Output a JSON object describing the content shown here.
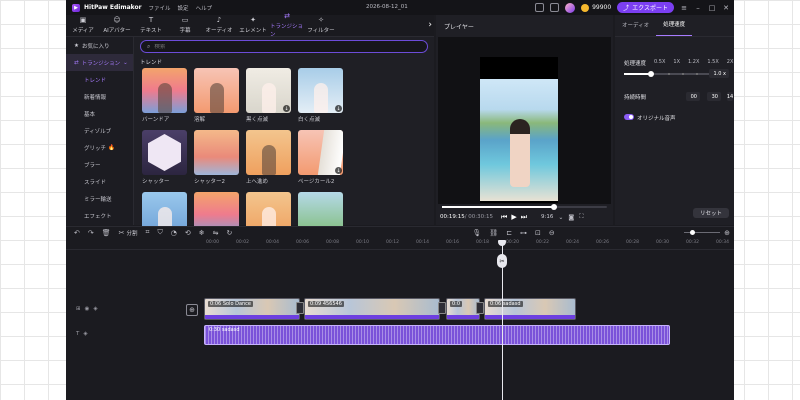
{
  "app": {
    "name": "HitPaw Edimakor",
    "menu": [
      "ファイル",
      "設定",
      "ヘルプ"
    ],
    "project_date": "2026-08-12_01",
    "coins": "99900",
    "export_label": "エクスポート"
  },
  "tabs": [
    {
      "label": "メディア",
      "icon": "▣"
    },
    {
      "label": "AIアバター",
      "icon": "☺"
    },
    {
      "label": "テキスト",
      "icon": "T"
    },
    {
      "label": "字幕",
      "icon": "▭"
    },
    {
      "label": "オーディオ",
      "icon": "♪"
    },
    {
      "label": "エレメント",
      "icon": "✦"
    },
    {
      "label": "トランジション",
      "icon": "⇄"
    },
    {
      "label": "フィルター",
      "icon": "✧"
    }
  ],
  "sidebar": {
    "favorites": "お気に入り",
    "transitions": "トランジション",
    "subs": [
      "トレンド",
      "新着情報",
      "基本",
      "ディゾルブ",
      "グリッチ",
      "ブラー",
      "スライド",
      "ミラー輪送",
      "エフェクト"
    ]
  },
  "search": {
    "placeholder": "検索"
  },
  "section": {
    "title": "トレンド"
  },
  "thumbnails": [
    {
      "label": "バーンドア"
    },
    {
      "label": "溶解"
    },
    {
      "label": "黒く点滅"
    },
    {
      "label": "白く点滅"
    },
    {
      "label": "シャッター"
    },
    {
      "label": "シャッター2"
    },
    {
      "label": "上へ進め"
    },
    {
      "label": "ページカール2"
    },
    {
      "label": ""
    },
    {
      "label": ""
    },
    {
      "label": ""
    },
    {
      "label": ""
    }
  ],
  "player": {
    "title": "プレイヤー",
    "current_time": "00:19:15",
    "total_time": "/ 00:30:15",
    "aspect": "9:16",
    "progress": 0.68
  },
  "properties": {
    "tabs": [
      "オーディオ",
      "処理速度"
    ],
    "speed_label": "処理速度",
    "speed_ticks": [
      "0.5X",
      "1X",
      "1.2X",
      "1.5X",
      "2X"
    ],
    "speed_value": "1.0",
    "speed_unit": "x",
    "duration_label": "持続時間",
    "duration": [
      "00",
      "30",
      "14"
    ],
    "pitch_label": "オリジナル音声",
    "reset_label": "リセット"
  },
  "toolbar": {
    "split_label": "分割"
  },
  "ruler": [
    "00:00",
    "00:02",
    "00:04",
    "00:06",
    "00:08",
    "00:10",
    "00:12",
    "00:14",
    "00:16",
    "00:18",
    "00:20",
    "00:22",
    "00:24",
    "00:26",
    "00:28",
    "00:30",
    "00:32",
    "00:34",
    "00:36",
    "00:38"
  ],
  "timeline": {
    "clips": [
      {
        "label": "0:06 Solo Dance"
      },
      {
        "label": "0:09 456546"
      },
      {
        "label": "0:0"
      },
      {
        "label": "0:06 sadasd"
      }
    ],
    "audio": {
      "label": "0:30 sadasd"
    }
  }
}
